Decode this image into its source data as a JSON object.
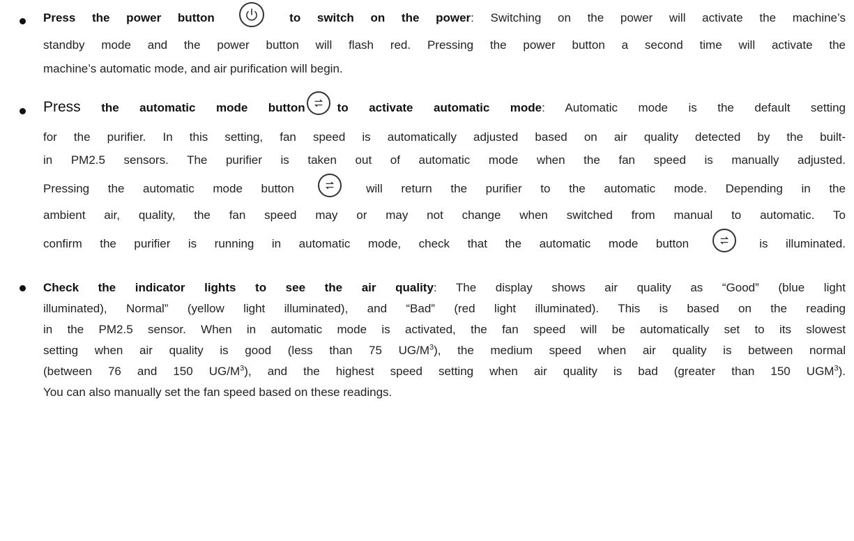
{
  "items": [
    {
      "title": "Press the power button",
      "title_rest": "to switch on the power",
      "line1_tail": ": Switching on the power will activate the machine’s",
      "line2": "standby mode and the power button will flash red. Pressing the power button a second time will activate the",
      "line3": "machine’s automatic mode, and air purification will begin."
    },
    {
      "title_first": "Press",
      "title_mid": "the automatic mode button",
      "title_rest": "to activate automatic mode",
      "line1_tail": ": Automatic mode is the default setting",
      "line2": "for the purifier. In this setting, fan speed is automatically adjusted based on air quality detected by the built-",
      "line3": "in PM2.5 sensors. The purifier is taken out of automatic mode when the fan speed is manually adjusted.",
      "line4_a": "Pressing the automatic mode button",
      "line4_b": "will return the purifier to the automatic mode. Depending in the",
      "line5": "ambient air, quality, the fan speed may or may not change when switched from manual to automatic. To",
      "line6_a": "confirm the purifier is running in automatic mode, check that the automatic mode button",
      "line6_b": "is illuminated."
    },
    {
      "title": "Check the indicator lights to see the air quality",
      "line1_tail": ": The display shows air quality as “Good” (blue light",
      "line2": "illuminated), Normal” (yellow light illuminated), and “Bad” (red light illuminated). This is based on the reading",
      "line3": "in the PM2.5 sensor. When in automatic mode is activated, the fan speed will be automatically set to its slowest",
      "line4_a": "setting when air quality is good (less than 75 UG/M",
      "line4_b": "), the medium speed when air quality is between normal",
      "line5_a": "(between 76 and 150 UG/M",
      "line5_b": "), and the highest speed setting when air quality is bad (greater than 150 UGM",
      "line5_c": ").",
      "line6": "You can also manually set the fan speed based on these readings.",
      "sup": "3"
    }
  ],
  "icons": {
    "power": "power-icon",
    "auto": "auto-mode-icon"
  }
}
